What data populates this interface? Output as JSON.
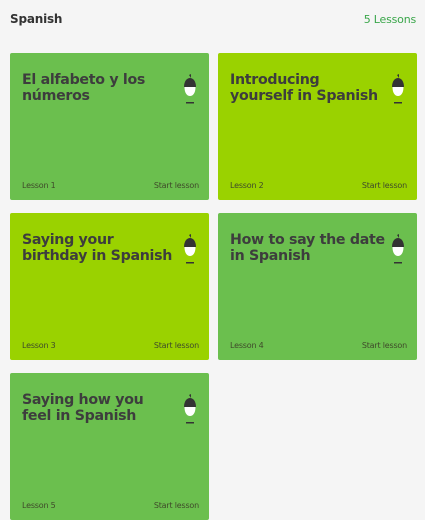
{
  "header": {
    "title": "Spanish",
    "lesson_count": "5 Lessons"
  },
  "colors": {
    "card_green": "#6bbf4e",
    "card_lime": "#9ad200",
    "accent": "#3aa64a"
  },
  "lessons": [
    {
      "title": "El alfabeto y los números",
      "lesson_label": "Lesson 1",
      "action": "Start lesson",
      "color": "#6bbf4e",
      "icon": "acorn-icon"
    },
    {
      "title": "Introducing yourself in Spanish",
      "lesson_label": "Lesson 2",
      "action": "Start lesson",
      "color": "#9ad200",
      "icon": "acorn-icon"
    },
    {
      "title": "Saying your birthday in Spanish",
      "lesson_label": "Lesson 3",
      "action": "Start lesson",
      "color": "#9ad200",
      "icon": "acorn-icon"
    },
    {
      "title": "How to say the date in Spanish",
      "lesson_label": "Lesson 4",
      "action": "Start lesson",
      "color": "#6bbf4e",
      "icon": "acorn-icon"
    },
    {
      "title": "Saying how you feel in Spanish",
      "lesson_label": "Lesson 5",
      "action": "Start lesson",
      "color": "#6bbf4e",
      "icon": "acorn-icon"
    }
  ]
}
